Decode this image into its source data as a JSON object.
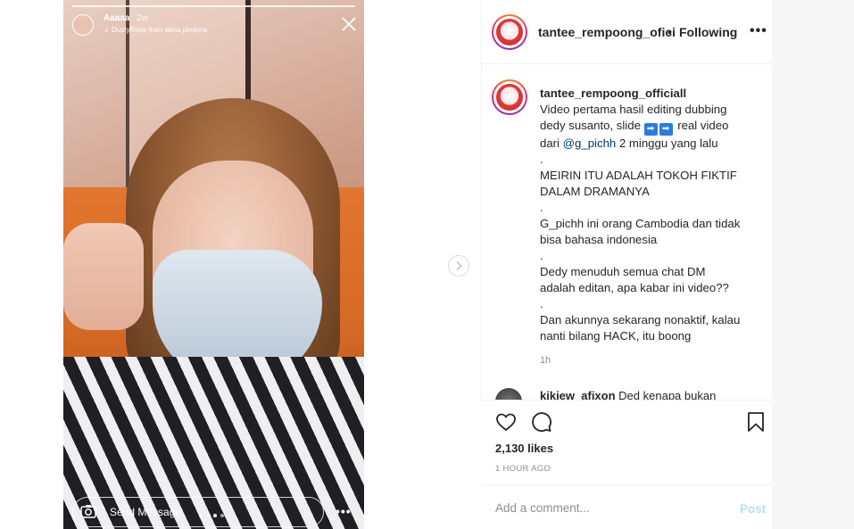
{
  "story": {
    "username": "Aaaaa",
    "time": "2w",
    "music": "DustyRose from daria.pimkina",
    "send_message": "Send Message",
    "current_slide": 2,
    "slide_count": 4
  },
  "post": {
    "username": "tantee_rempoong_ofici",
    "separator": "•",
    "follow_status": "Following",
    "caption": {
      "username": "tantee_rempoong_officiall",
      "line1": "Video pertama hasil editing dubbing",
      "line2a": "dedy susanto, slide",
      "line2b": "real video",
      "line3a": "dari",
      "mention": "@g_pichh",
      "line3b": "2 minggu yang lalu",
      "dot1": ".",
      "line4": "MEIRIN ITU ADALAH TOKOH FIKTIF",
      "line5": "DALAM DRAMANYA",
      "dot2": ".",
      "line6": "G_pichh ini orang Cambodia dan tidak",
      "line7": "bisa bahasa indonesia",
      "dot3": ".",
      "line8": "Dedy menuduh semua chat DM",
      "line9": "adalah editan, apa kabar ini video??",
      "dot4": ".",
      "line10": "Dan akunnya sekarang nonaktif, kalau",
      "line11": "nanti bilang HACK, itu boong",
      "time": "1h"
    },
    "comment_preview": {
      "username": "kikiew_afixon",
      "text": "Ded kenapa bukan"
    },
    "likes": "2,130 likes",
    "posted": "1 HOUR AGO",
    "add_comment_placeholder": "Add a comment...",
    "post_label": "Post"
  },
  "icons": {
    "close": "close-icon",
    "camera": "camera-icon",
    "next": "chevron-right-icon",
    "like": "heart-icon",
    "comment": "speech-bubble-icon",
    "save": "bookmark-icon",
    "more": "more-horizontal-icon"
  },
  "colors": {
    "mention": "#00376b",
    "post_disabled": "#b2dffc",
    "meta": "#8e8e8e"
  }
}
